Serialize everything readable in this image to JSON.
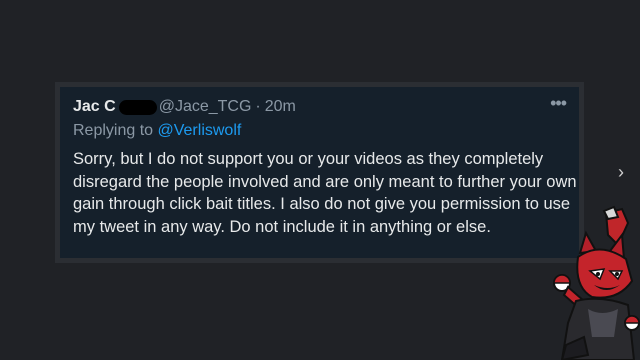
{
  "tweet": {
    "author_name": "Jac C",
    "handle": "@Jace_TCG",
    "separator": "·",
    "time": "20m",
    "more_icon": "more-icon",
    "replying_prefix": "Replying to",
    "replying_to": "@Verliswolf",
    "text": "Sorry, but I do not support you or your videos as they completely disregard the people involved and are only meant to further your own gain through click bait titles. I also do not give you permission to use my tweet in any way. Do not include it in anything or else."
  },
  "navigation": {
    "next_icon": "chevron-right-icon",
    "next_glyph": "›"
  },
  "overlay": {
    "mascot": "red-wolf-mascot-drawing"
  }
}
